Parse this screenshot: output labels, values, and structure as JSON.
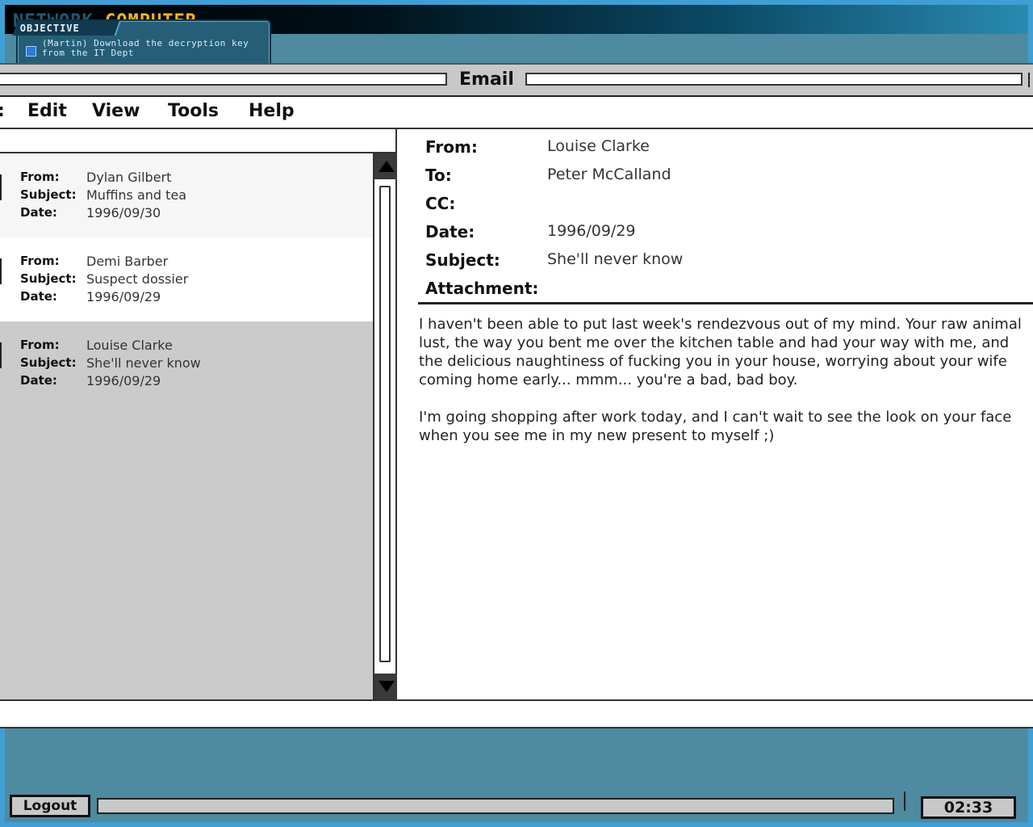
{
  "os": {
    "title_word1": "NETWORK",
    "title_word2": "COMPUTER",
    "objective_label": "OBJECTIVE",
    "objective_text": "(Martin) Download the decryption key from the IT Dept"
  },
  "app": {
    "title": "Email",
    "menu": [
      "Edit",
      "View",
      "Tools",
      "Help"
    ],
    "menu_partial": ":"
  },
  "messages": [
    {
      "from_label": "From:",
      "subject_label": "Subject:",
      "date_label": "Date:",
      "from": "Dylan Gilbert",
      "subject": "Muffins and tea",
      "date": "1996/09/30"
    },
    {
      "from_label": "From:",
      "subject_label": "Subject:",
      "date_label": "Date:",
      "from": "Demi Barber",
      "subject": "Suspect dossier",
      "date": "1996/09/29"
    },
    {
      "from_label": "From:",
      "subject_label": "Subject:",
      "date_label": "Date:",
      "from": "Louise Clarke",
      "subject": "She'll never know",
      "date": "1996/09/29"
    }
  ],
  "detail": {
    "labels": {
      "from": "From:",
      "to": "To:",
      "cc": "CC:",
      "date": "Date:",
      "subject": "Subject:",
      "attachment": "Attachment:"
    },
    "from": "Louise Clarke",
    "to": "Peter McCalland",
    "cc": "",
    "date": "1996/09/29",
    "subject": "She'll never know",
    "attachment": "",
    "body": "I haven't been able to put last week's rendezvous out of my mind. Your raw animal lust, the way you bent me over the kitchen table and had your way with me, and the delicious naughtiness of fucking you in your house, worrying about your wife coming home early... mmm... you're a bad, bad boy.\n\nI'm going shopping after work today, and I can't wait to see the look on your face when you see me in my new present to myself ;)"
  },
  "taskbar": {
    "logout_label": "Logout",
    "clock": "02:33"
  }
}
